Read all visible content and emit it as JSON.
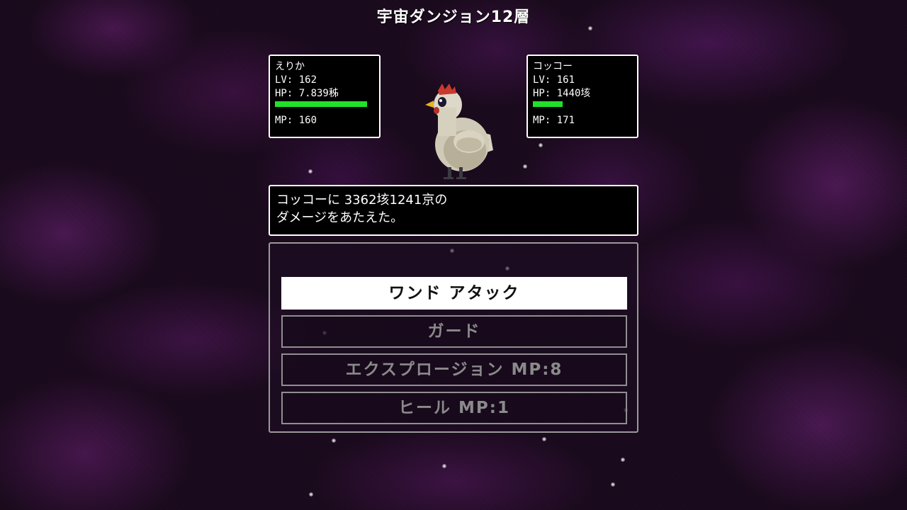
{
  "floor_title": "宇宙ダンジョン12層",
  "player": {
    "name": "えりか",
    "lv": "LV: 162",
    "hp": "HP: 7.839秭",
    "hp_fraction": 1.0,
    "mp": "MP: 160"
  },
  "enemy": {
    "name": "コッコー",
    "lv": "LV: 161",
    "hp": "HP: 1440垓",
    "hp_fraction": 0.32,
    "mp": "MP: 171",
    "sprite": "chicken"
  },
  "message": {
    "line1": "コッコーに 3362垓1241京の",
    "line2": "ダメージをあたえた。"
  },
  "commands": [
    {
      "label": "ワンド アタック",
      "selected": true
    },
    {
      "label": "ガード",
      "selected": false
    },
    {
      "label": "エクスプロージョン MP:8",
      "selected": false
    },
    {
      "label": "ヒール MP:1",
      "selected": false
    }
  ],
  "colors": {
    "hp_bar": "#22e02a",
    "panel_border": "#ffffff",
    "panel_bg": "#000000",
    "selected_bg": "#ffffff",
    "disabled_text": "#8a8a8a",
    "background": "#1c0b1f"
  }
}
